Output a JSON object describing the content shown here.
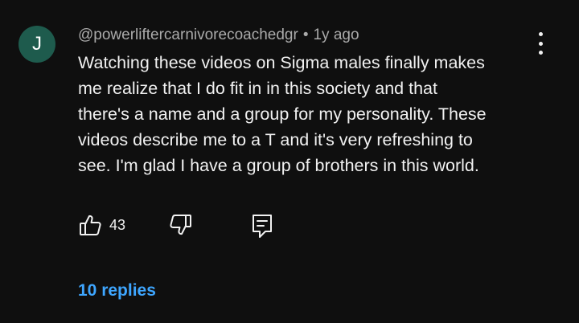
{
  "comment": {
    "avatar_letter": "J",
    "avatar_color": "#1e5b4d",
    "author": "@powerliftercarnivorecoachedgr",
    "separator": "•",
    "time": "1y ago",
    "text_lines": [
      "Watching these videos on Sigma males finally makes",
      "me realize that I do fit in in this society and that",
      "there's a name and a group for my personality. These",
      "videos describe me to a T and it's very refreshing to",
      "see. I'm glad I have a group of brothers in this world."
    ],
    "like_count": "43",
    "replies_label": "10 replies"
  },
  "icons": {
    "more": "more-vert-icon",
    "like": "thumbs-up-icon",
    "dislike": "thumbs-down-icon",
    "reply": "reply-comment-icon"
  },
  "colors": {
    "background": "#0f0f0f",
    "text": "#f1f1f1",
    "secondary_text": "#aaaaaa",
    "link": "#3ea6ff"
  }
}
